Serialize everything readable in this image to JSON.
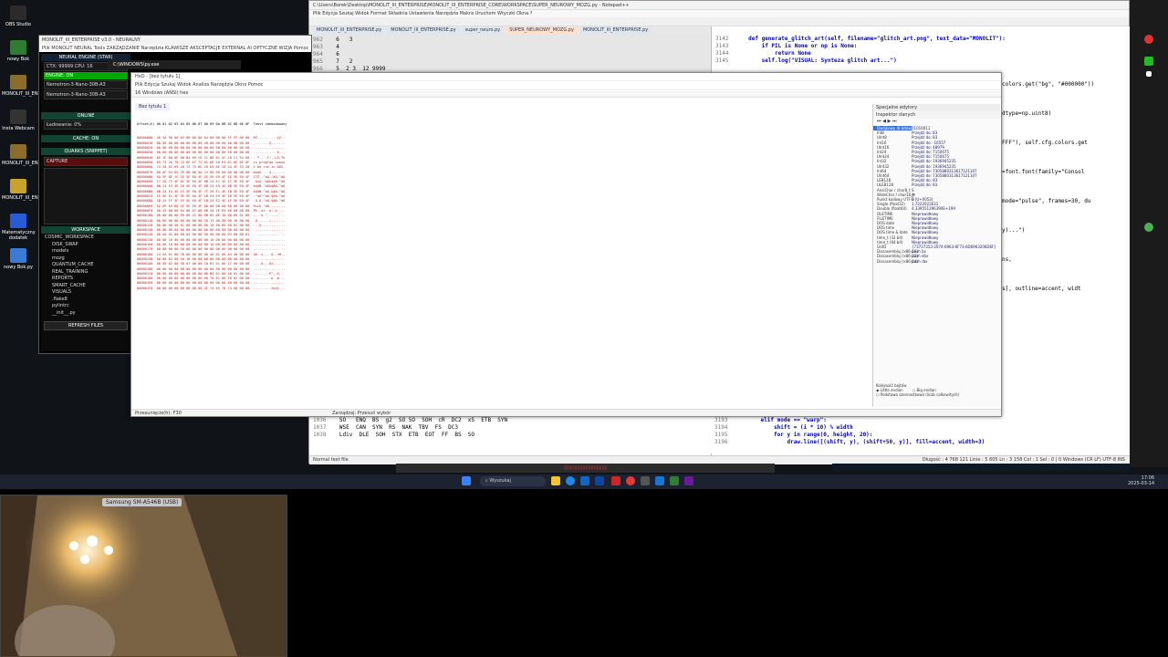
{
  "desktop": {
    "icons": [
      {
        "label": "OBS Studio",
        "color": "#2b2b2b"
      },
      {
        "label": "nowy Bok",
        "color": "#2e7d32"
      },
      {
        "label": "MONOLIT_III_EN...",
        "color": "#8a6d2b"
      },
      {
        "label": "Insta Webcam",
        "color": "#333"
      },
      {
        "label": "MONOLIT_III_EN...",
        "color": "#8a6d2b"
      },
      {
        "label": "MONOLIT_III_EN...",
        "color": "#c8a32b"
      },
      {
        "label": "Matematyczny dodatek",
        "color": "#2a5bd7"
      },
      {
        "label": "nowy Bok.py",
        "color": "#3a7bd5"
      }
    ]
  },
  "notepad": {
    "title": "C:\\Users\\Borek\\Desktop\\MONOLIT_III_ENTERPRISE\\MONOLIT_III_ENTERPRISE_CORE\\WORKSPACE\\SUPER_NEUROWY_MOZG.py - Notepad++",
    "menu": "Plik  Edycja  Szukaj  Widok  Format  Składnia  Ustawienia  Narzędzia  Makra  Uruchom  Wtyczki  Okna  ?",
    "tabs": [
      {
        "label": "MONOLIT_III_ENTERPRISE.py",
        "active": false
      },
      {
        "label": "MONOLIT_III_ENTERPRISE.py",
        "active": false
      },
      {
        "label": "super_neuro.py",
        "active": false
      },
      {
        "label": "SUPER_NEUROWY_MOZG.py",
        "active": true
      },
      {
        "label": "MONOLIT_III_ENTERPRISE.py",
        "active": false
      }
    ],
    "left_lines": [
      {
        "num": "962",
        "text": "  6   3"
      },
      {
        "num": "963",
        "text": "  4"
      },
      {
        "num": "964",
        "text": "  6"
      },
      {
        "num": "965",
        "text": "  7   2"
      },
      {
        "num": "966",
        "text": "  5  2 3  12 9999"
      }
    ],
    "right_lines": [
      {
        "num": "3142",
        "code": "    def generate_glitch_art(self, filename=\"glitch_art.png\", text_data=\"MONOLIT\"):"
      },
      {
        "num": "3143",
        "code": "        if PIL is None or np is None:"
      },
      {
        "num": "3144",
        "code": "            return None"
      },
      {
        "num": "3145",
        "code": "        self.log(\"VISUAL: Synteza glitch art...\")"
      }
    ],
    "right_fragments": [
      "colors.get(\"bg\", \"#000000\"))",
      "dtype=np.uint8)",
      "FFF\"), self.cfg.colors.get",
      "=font.font(family=\"Consol",
      "mode=\"pulse\", frames=30, du",
      "y)...\")",
      "ns,",
      "s], outline=accent, widt"
    ],
    "bottom_lines": [
      {
        "num": "3193",
        "code": "        elif mode == \"warp\":"
      },
      {
        "num": "3194",
        "code": "            shift = (i * 10) % width"
      },
      {
        "num": "3195",
        "code": "            for y in range(0, height, 20):"
      },
      {
        "num": "3196",
        "code": "                draw.line([(shift, y), (shift+50, y)], fill=accent, width=3)"
      }
    ],
    "bottom_left_lines": [
      {
        "num": "1036",
        "text": "  SO   ENQ  BS  g2  SO SO  SOH  cR  DC2  xS  ETB  SYN"
      },
      {
        "num": "1037",
        "text": "  WSE  CAN  SYN  RS  NAK  TBV  FS  DC3"
      },
      {
        "num": "1038",
        "text": "  Ldiv  DLE  SOH  STX  ETB  EOT  FF  BS  SO"
      }
    ],
    "status": "Normal text file",
    "status_right": "Długość : 4 768 121   Linie : 5 605     Ln : 3 158   Col : 1   Sel : 0 | 0     Windows (CR LF)   UTF-8   INS"
  },
  "neural": {
    "title": "MONOLIT_III_ENTERPRISE v3.0 - NEURALNY",
    "menu": "Plik  MONOLIT  NEURAL  Tools  ZARZĄDZANIE  Narzędzia  KLAWISZE  AKSCEPTACJE  EXTERNAL AI  OPTYCZNE  WIZJA  Pomoc",
    "engine_title": "NEURAL ENGINE (STAR)",
    "ctx_label": "CTX: 99999  CPU: 16",
    "engine_badge": "ENGINE: ON",
    "models": [
      "Nemotron-3-Nano-30B-A3",
      "Nemotron-3-Nano-30B-A3"
    ],
    "online_title": "ONLINE",
    "loading": "Ładowanie: 0%",
    "cache_title": "CACHE: ON",
    "quarks_title": "QUARKS (SNIPPET)",
    "capture": "CAPTURE",
    "workspace_title": "WORKSPACE",
    "tree": [
      "COSMIC_WORKSPACE",
      "DISK_SWAP",
      "models",
      "mozg",
      "QUANTUM_CACHE",
      "REAL_TRAINING",
      "REPORTS",
      "SMART_CACHE",
      "VISUALS",
      ".flake8",
      "pylintrc",
      "__init__.py"
    ],
    "refresh": "REFRESH FILES"
  },
  "cmdtab": {
    "label": "C:\\WINDOWS\\py.exe"
  },
  "hex": {
    "title": "HxD - [bez tytułu 1]",
    "menu": "Plik  Edycja  Szukaj  Widok  Analiza  Narzędzia  Okno  Pomoc",
    "toolbar": "16   Windows (ANSI)   hex",
    "tab": "Bez tytułu 1",
    "header": "Offset(h) 00 01 02 03 04 05 06 07 08 09 0A 0B 0C 0D 0E 0F  Tekst zdekodowany",
    "rows": [
      "00000000  4D 5A 90 00 03 00 00 00 04 00 00 00 FF FF 00 00  MZ..........ÿÿ..",
      "00000010  B8 00 00 00 00 00 00 00 40 00 00 00 00 00 00 00  ¸.......@.......",
      "00000020  00 00 00 00 00 00 00 00 00 00 00 00 00 00 00 00  ................",
      "00000030  00 00 00 00 00 00 00 00 00 00 00 00 E8 00 00 00  ............è...",
      "00000040  0E 1F BA 0E 00 B4 09 CD 21 B8 01 4C CD 21 54 68  ..º..´.Í!¸.LÍ!Th",
      "00000050  69 73 20 70 72 6F 67 72 61 6D 20 63 61 6E 6E 6F  is program canno",
      "00000060  74 20 62 65 20 72 75 6E 20 69 6E 20 44 4F 53 20  t be run in DOS ",
      "00000070  6D 6F 64 65 2E 0D 0D 0A 24 00 00 00 00 00 00 00  mode....$.......",
      "00000080  5A 3F 8E 1C 1E 5E E0 4F 1E 5E E0 4F 1E 5E E0 4F  Z?Ž..^àO.^àO.^àO",
      "00000090  17 26 73 4F 0C 5E E0 4F 6B 24 E1 4E 1C 5E E0 4F  .&sO.^àOk$áN.^àO",
      "000000A0  6B 24 E3 4E 16 5E E0 4F 6B 24 E5 4E 0B 5E E0 4F  k$ãN.^àOk$åN.^àO",
      "000000B0  6B 24 E4 4E 15 5E E0 4F 7F 26 E1 4E 1B 5E E0 4F  k$äN.^àO.&áN.^àO",
      "000000C0  1E 5E E1 4F 5E 5E E0 4F 1B 24 E9 4E 1D 5E E0 4F  .^áO^^àO.$éN.^àO",
      "000000D0  1B 24 1F 4F 1F 5E E0 4F 1B 24 E2 4E 1F 5E E0 4F  .$.O.^àO.$âN.^àO",
      "000000E0  52 69 63 68 1E 5E E0 4F 00 00 00 00 00 00 00 00  Rich.^àO........",
      "000000F0  50 45 00 00 64 86 07 00 6B 3A 2E 65 00 00 00 00  PE..d†..k:.e....",
      "00000100  00 00 00 00 F0 00 22 00 0B 02 0E 1D 00 60 01 00  ....ð.\"......`..",
      "00000110  00 D6 00 00 00 00 00 00 28 13 00 00 00 10 00 00  .Ö......(.......",
      "00000120  00 00 00 40 01 00 00 00 00 10 00 00 00 02 00 00  ...@............",
      "00000130  06 00 00 00 00 00 00 00 06 00 00 00 00 00 00 00  ................",
      "00000140  00 A0 02 00 00 04 00 00 00 00 00 00 03 00 60 81  . ............`.",
      "00000150  00 00 10 00 00 00 00 00 00 10 00 00 00 00 00 00  ................",
      "00000160  00 00 10 00 00 00 00 00 00 10 00 00 00 00 00 00  ................",
      "00000170  00 00 00 00 10 00 00 00 00 00 00 00 00 00 00 00  ................",
      "00000180  C4 EA 01 00 78 00 00 00 00 40 02 00 A4 4D 00 00  Äê..x....@..¤M..",
      "00000190  00 00 02 00 10 10 00 00 00 00 00 00 00 00 00 00  ................",
      "000001A0  00 90 02 00 30 07 00 00 C0 B1 01 00 1C 00 00 00  ....0...À±......",
      "000001B0  00 00 00 00 00 00 00 00 00 00 00 00 00 00 00 00  ................",
      "000001C0  00 00 00 00 00 00 00 00 80 B0 01 00 40 01 00 00  ........€°..@...",
      "000001D0  00 00 00 00 00 00 00 00 00 70 01 00 F8 02 00 00  .........p..ø...",
      "000001E0  00 00 00 00 00 00 00 00 00 00 00 00 00 00 00 00  ................",
      "000001F0  00 00 00 00 00 00 00 00 2E 74 65 78 74 00 00 00  .........text..."
    ],
    "status": "Przesunięcie(h): F30",
    "status2": "Zarządzaj: Przesuń wybór"
  },
  "inspector": {
    "title": "Specjalne edytory",
    "subtitle": "Inspektor danych",
    "rows": [
      {
        "k": "Dwójkowy (8 bitów)",
        "v": "01010011",
        "sel": true
      },
      {
        "k": "Int8",
        "v": "Przejdź do: 83"
      },
      {
        "k": "UInt8",
        "v": "Przejdź do: 83"
      },
      {
        "k": "Int16",
        "v": "Przejdź do: -16557"
      },
      {
        "k": "UInt16",
        "v": "Przejdź do: 48979"
      },
      {
        "k": "Int24",
        "v": "Przejdź do: 7150675"
      },
      {
        "k": "UInt24",
        "v": "Przejdź do: 7150675"
      },
      {
        "k": "Int32",
        "v": "Przejdź do: 1936945235"
      },
      {
        "k": "UInt32",
        "v": "Przejdź do: 1936945235"
      },
      {
        "k": "Int64",
        "v": "Przejdź do: 7305880313617121107"
      },
      {
        "k": "UInt64",
        "v": "Przejdź do: 7305880313617121107"
      },
      {
        "k": "LEB128",
        "v": "Przejdź do: 83"
      },
      {
        "k": "ULEB128",
        "v": "Przejdź do: 83"
      },
      {
        "k": "AnsiChar / char8_t",
        "v": "S"
      },
      {
        "k": "WideChar / char16_t",
        "v": "伓"
      },
      {
        "k": "Punkt kodowy UTF-8",
        "v": "S (U+0053)"
      },
      {
        "k": "Single (float32)",
        "v": "1,7222022E31"
      },
      {
        "k": "Double (float64)",
        "v": "4,339551296390E+199"
      },
      {
        "k": "OLETIME",
        "v": "Nieprawidłowy"
      },
      {
        "k": "FILETIME",
        "v": "Nieprawidłowy"
      },
      {
        "k": "DOS date",
        "v": "Nieprawidłowy"
      },
      {
        "k": "DOS time",
        "v": "Nieprawidłowy"
      },
      {
        "k": "DOS time & date",
        "v": "Nieprawidłowy"
      },
      {
        "k": "time_t (32 bit)",
        "v": "Nieprawidłowy"
      },
      {
        "k": "time_t (64 bit)",
        "v": "Nieprawidłowy"
      },
      {
        "k": "GUID",
        "v": "{73737353-2074-6963-6F73-6D6963206D6F}"
      },
      {
        "k": "Dissasembluj (x86-16)",
        "v": "push bx"
      },
      {
        "k": "Dissasembluj (x86-32)",
        "v": "push ebx"
      },
      {
        "k": "Dissasembluj (x86-64)",
        "v": "push rbx"
      }
    ],
    "byteorder_title": "Kolejność bajtów",
    "little": "Little endian",
    "big": "Big endian",
    "hexbase": "Podstawa szesnastkowa (liczb całkowitych)"
  },
  "taskbar": {
    "search": "Wyszukaj",
    "time": "17:06",
    "date": "2025-03-14"
  },
  "webcam": {
    "label": "Samsung SM-A546B (USB)"
  },
  "popup": {
    "text": "ÿÿÿÿÿÿÿÿÿÿÿÿÿÿÿÿ"
  }
}
